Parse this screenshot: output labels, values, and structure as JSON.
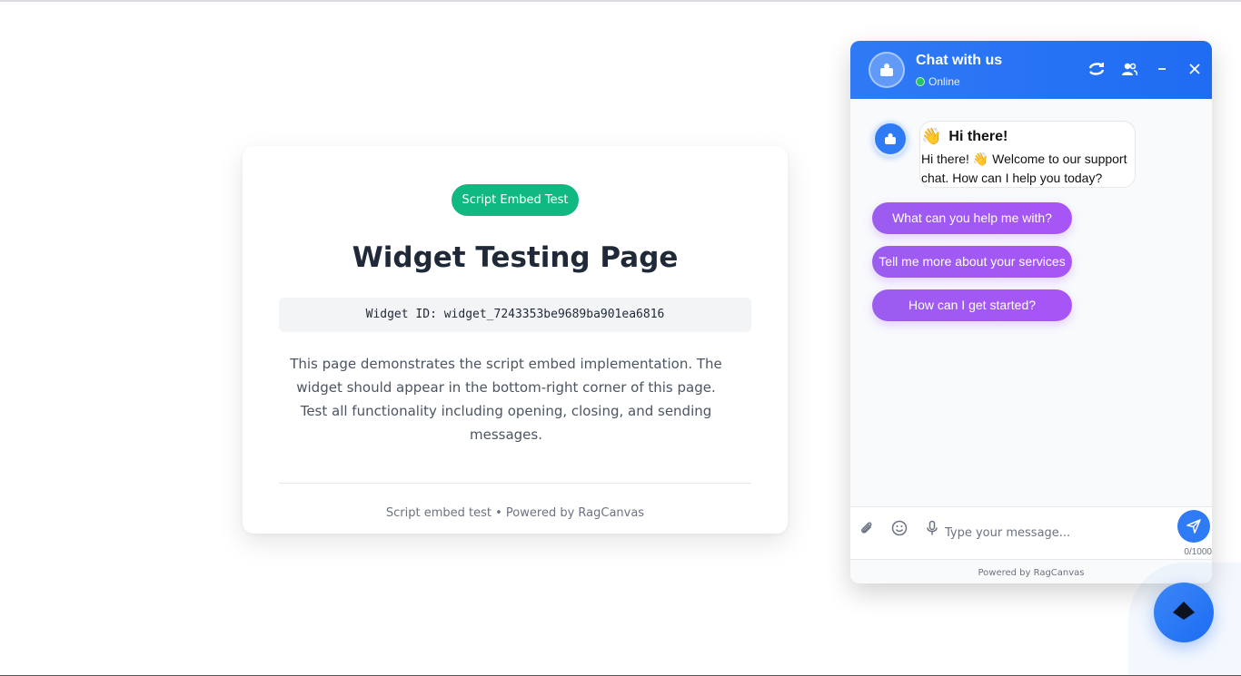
{
  "card": {
    "badge": "Script Embed Test",
    "title": "Widget Testing Page",
    "widget_id": "Widget ID: widget_7243353be9689ba901ea6816",
    "description": "This page demonstrates the script embed implementation. The widget should appear in the bottom-right corner of this page. Test all functionality including opening, closing, and sending messages.",
    "footer": "Script embed test • Powered by RagCanvas"
  },
  "chat": {
    "title": "Chat with us",
    "status": "Online",
    "greeting_emoji": "👋",
    "greeting_title": "Hi there!",
    "greeting_text": "Hi there! 👋 Welcome to our support chat. How can I help you today?",
    "suggestions": [
      "What can you help me with?",
      "Tell me more about your services",
      "How can I get started?"
    ],
    "input_placeholder": "Type your message...",
    "char_count": "0/1000",
    "footer": "Powered by RagCanvas"
  },
  "colors": {
    "accent": "#2f7af5",
    "badge": "#10b981",
    "suggestion": "#a855f7",
    "online": "#22c55e"
  },
  "icons": {
    "header": [
      "refresh-icon",
      "users-icon",
      "minimize-icon",
      "close-icon"
    ],
    "input": [
      "paperclip-icon",
      "smile-icon",
      "microphone-icon",
      "send-icon"
    ],
    "launcher": "diamond-icon"
  }
}
